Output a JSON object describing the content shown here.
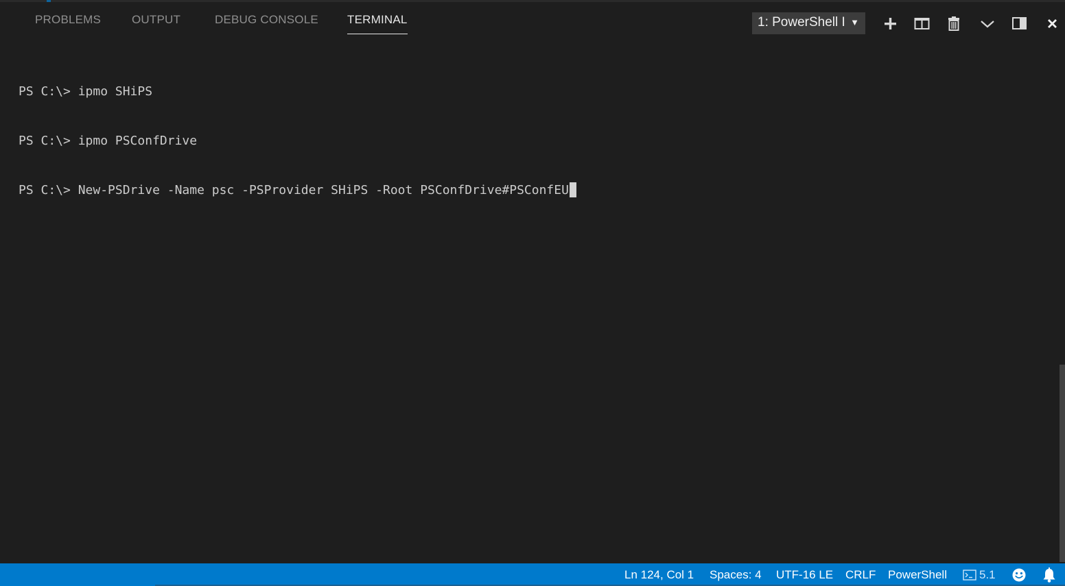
{
  "panel": {
    "tabs": [
      {
        "label": "PROBLEMS",
        "active": false
      },
      {
        "label": "OUTPUT",
        "active": false
      },
      {
        "label": "DEBUG CONSOLE",
        "active": false
      },
      {
        "label": "TERMINAL",
        "active": true
      }
    ],
    "terminal_select": {
      "value": "1: PowerShell I",
      "caret": "▼"
    },
    "toolbar_icons": [
      "add-icon",
      "split-icon",
      "trash-icon",
      "chevron-down-icon",
      "maximize-icon",
      "close-icon"
    ]
  },
  "terminal": {
    "lines": [
      "PS C:\\> ipmo SHiPS",
      "PS C:\\> ipmo PSConfDrive",
      "PS C:\\> New-PSDrive -Name psc -PSProvider SHiPS -Root PSConfDrive#PSConfEU"
    ]
  },
  "status_bar": {
    "position": "Ln 124, Col 1",
    "spaces": "Spaces: 4",
    "encoding": "UTF-16 LE",
    "eol": "CRLF",
    "language": "PowerShell",
    "version": "5.1",
    "icons": [
      "terminal-icon",
      "feedback-smiley-icon",
      "bell-icon"
    ]
  },
  "colors": {
    "background": "#1e1e1e",
    "status_bar": "#007acc",
    "tab_inactive": "#8f8f8f",
    "tab_active": "#e7e7e7",
    "terminal_text": "#cccccc"
  }
}
